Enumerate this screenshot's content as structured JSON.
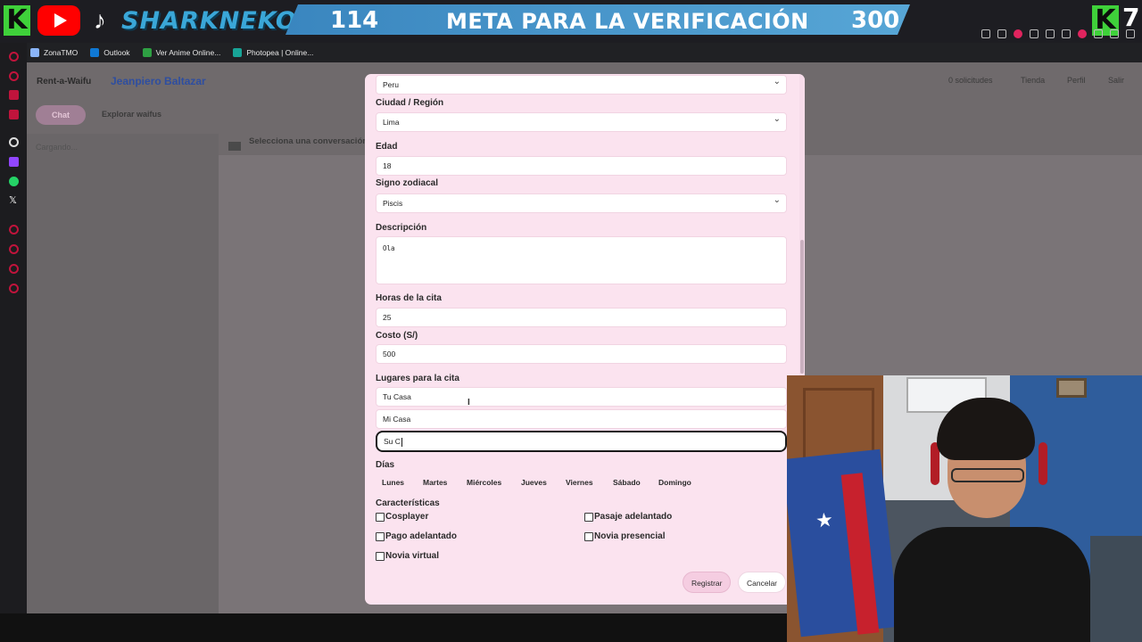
{
  "overlay": {
    "brand": "SHARKNEKO",
    "goal_current": "114",
    "goal_title": "META PARA LA VERIFICACIÓN",
    "goal_target": "300",
    "right_count": "7",
    "logo_letter": "K"
  },
  "bookmarks": [
    {
      "label": "ZonaTMO",
      "color": "#8ab4f8"
    },
    {
      "label": "Outlook",
      "color": "#0f78d4"
    },
    {
      "label": "Ver Anime Online...",
      "color": "#2ea043"
    },
    {
      "label": "Photopea | Online...",
      "color": "#18a497"
    }
  ],
  "background_page": {
    "site_name": "Rent-a-Waifu",
    "user_name": "Jeanpiero Baltazar",
    "nav": [
      "0 solicitudes",
      "Tienda",
      "Perfil",
      "Salir"
    ],
    "tab_chat": "Chat",
    "tab_explore": "Explorar waifus",
    "loading": "Cargando...",
    "selector": "Selecciona una conversación"
  },
  "form": {
    "country_value": "Peru",
    "city_label": "Ciudad / Región",
    "city_value": "Lima",
    "age_label": "Edad",
    "age_value": "18",
    "zodiac_label": "Signo zodiacal",
    "zodiac_value": "Piscis",
    "description_label": "Descripción",
    "description_value": "Ola",
    "hours_label": "Horas de la cita",
    "hours_value": "25",
    "cost_label": "Costo (S/)",
    "cost_value": "500",
    "places_label": "Lugares para la cita",
    "places": [
      "Tu Casa",
      "Mi Casa",
      "Su C"
    ],
    "days_label": "Días",
    "days": [
      "Lunes",
      "Martes",
      "Miércoles",
      "Jueves",
      "Viernes",
      "Sábado",
      "Domingo"
    ],
    "features_label": "Características",
    "features": [
      "Cosplayer",
      "Pasaje adelantado",
      "Pago adelantado",
      "Novia presencial",
      "Novia virtual"
    ],
    "submit_label": "Registrar",
    "cancel_label": "Cancelar"
  },
  "colors": {
    "modal_bg": "#fbe3ef",
    "goal_bar": "#3a86bf",
    "brand_green": "#3fd13a",
    "primary_button": "#f5cde1"
  }
}
